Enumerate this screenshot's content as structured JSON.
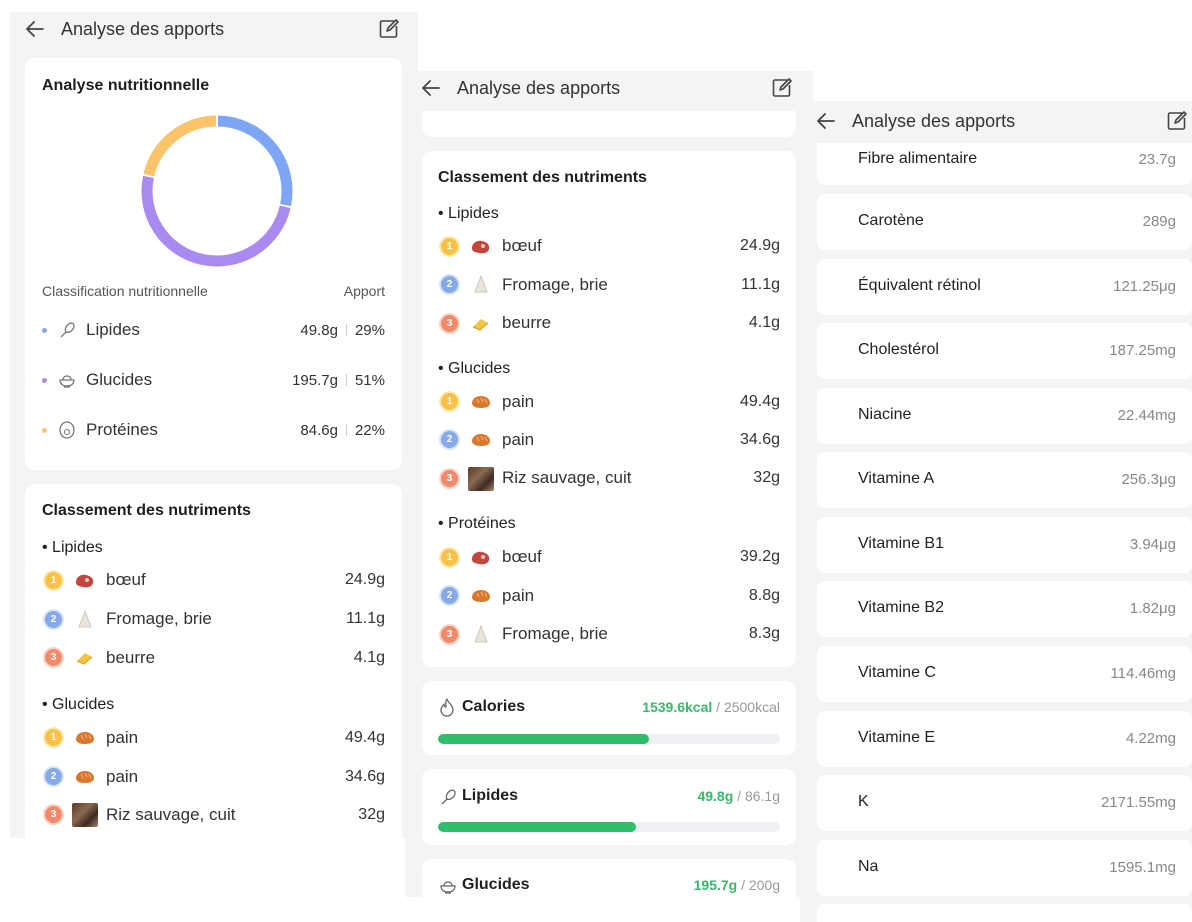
{
  "header": {
    "title": "Analyse des apports"
  },
  "analysis": {
    "title": "Analyse nutritionnelle",
    "col_classification": "Classification nutritionnelle",
    "col_intake": "Apport",
    "items": [
      {
        "name": "Lipides",
        "amount": "49.8g",
        "percent": "29%",
        "color": "#7ea6f5",
        "icon": "drumstick-icon"
      },
      {
        "name": "Glucides",
        "amount": "195.7g",
        "percent": "51%",
        "color": "#a88af0",
        "icon": "rice-bowl-icon"
      },
      {
        "name": "Protéines",
        "amount": "84.6g",
        "percent": "22%",
        "color": "#fcc46a",
        "icon": "egg-icon"
      }
    ],
    "donut_shares": [
      29,
      51,
      22
    ]
  },
  "ranking": {
    "title": "Classement des nutriments",
    "groups": [
      {
        "name": "Lipides",
        "items": [
          {
            "rank": "1",
            "food": "bœuf",
            "value": "24.9g",
            "icon": "beef-icon"
          },
          {
            "rank": "2",
            "food": "Fromage, brie",
            "value": "11.1g",
            "icon": "cheese-icon"
          },
          {
            "rank": "3",
            "food": "beurre",
            "value": "4.1g",
            "icon": "butter-icon"
          }
        ]
      },
      {
        "name": "Glucides",
        "items": [
          {
            "rank": "1",
            "food": "pain",
            "value": "49.4g",
            "icon": "bread-icon"
          },
          {
            "rank": "2",
            "food": "pain",
            "value": "34.6g",
            "icon": "bread-icon"
          },
          {
            "rank": "3",
            "food": "Riz sauvage, cuit",
            "value": "32g",
            "icon": "wild-rice-photo"
          }
        ]
      },
      {
        "name": "Protéines",
        "items": [
          {
            "rank": "1",
            "food": "bœuf",
            "value": "39.2g",
            "icon": "beef-icon"
          },
          {
            "rank": "2",
            "food": "pain",
            "value": "8.8g",
            "icon": "bread-icon"
          },
          {
            "rank": "3",
            "food": "Fromage, brie",
            "value": "8.3g",
            "icon": "cheese-icon"
          }
        ]
      }
    ]
  },
  "progress": [
    {
      "name": "Calories",
      "value": "1539.6kcal",
      "target": "/ 2500kcal",
      "fraction": 0.616,
      "icon": "flame-icon"
    },
    {
      "name": "Lipides",
      "value": "49.8g",
      "target": "/ 86.1g",
      "fraction": 0.578,
      "icon": "drumstick-icon"
    },
    {
      "name": "Glucides",
      "value": "195.7g",
      "target": "/ 200g",
      "fraction": 0.98,
      "icon": "rice-bowl-icon"
    }
  ],
  "nutrients": [
    {
      "name": "Fibre alimentaire",
      "value": "23.7g"
    },
    {
      "name": "Carotène",
      "value": "289g"
    },
    {
      "name": "Équivalent rétinol",
      "value": "121.25μg"
    },
    {
      "name": "Cholestérol",
      "value": "187.25mg"
    },
    {
      "name": "Niacine",
      "value": "22.44mg"
    },
    {
      "name": "Vitamine A",
      "value": "256.3μg"
    },
    {
      "name": "Vitamine B1",
      "value": "3.94μg"
    },
    {
      "name": "Vitamine B2",
      "value": "1.82μg"
    },
    {
      "name": "Vitamine C",
      "value": "114.46mg"
    },
    {
      "name": "Vitamine E",
      "value": "4.22mg"
    },
    {
      "name": "K",
      "value": "2171.55mg"
    },
    {
      "name": "Na",
      "value": "1595.1mg"
    }
  ],
  "colors": {
    "accent_green": "#2ebd6b",
    "rank1": "#f9c146",
    "rank2": "#86a9e8",
    "rank3": "#f08a6a"
  }
}
